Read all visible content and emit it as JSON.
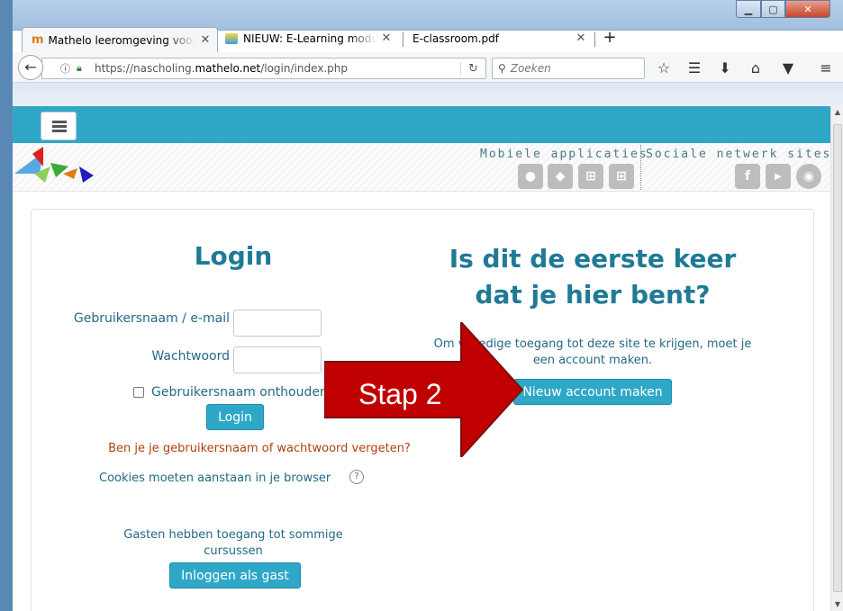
{
  "browser": {
    "tabs": [
      {
        "label": "Mathelo leeromgeving voor w",
        "active": true
      },
      {
        "label": "NIEUW: E-Learning module V",
        "active": false
      },
      {
        "label": "E-classroom.pdf",
        "active": false
      }
    ],
    "url_prefix": "https://nascholing.",
    "url_domain": "mathelo.net",
    "url_path": "/login/index.php",
    "search_placeholder": "Zoeken"
  },
  "header": {
    "mobile_label": "Mobiele applicaties",
    "social_label": "Sociale netwerk sites"
  },
  "login": {
    "title": "Login",
    "username_label": "Gebruikersnaam / e-mail",
    "password_label": "Wachtwoord",
    "remember_label": "Gebruikersnaam onthouden",
    "login_button": "Login",
    "forgot_link": "Ben je je gebruikersnaam of wachtwoord vergeten?",
    "cookies_text": "Cookies moeten aanstaan in je browser",
    "guests_text": "Gasten hebben toegang tot sommige cursussen",
    "guest_button": "Inloggen als gast"
  },
  "signup": {
    "title_line1": "Is dit de eerste keer",
    "title_line2": "dat je hier bent?",
    "instructions": "Om volledige toegang tot deze site te krijgen, moet je een account maken.",
    "new_account_button": "Nieuw account maken"
  },
  "overlay": {
    "label": "Stap 2",
    "color": "#c00000"
  }
}
